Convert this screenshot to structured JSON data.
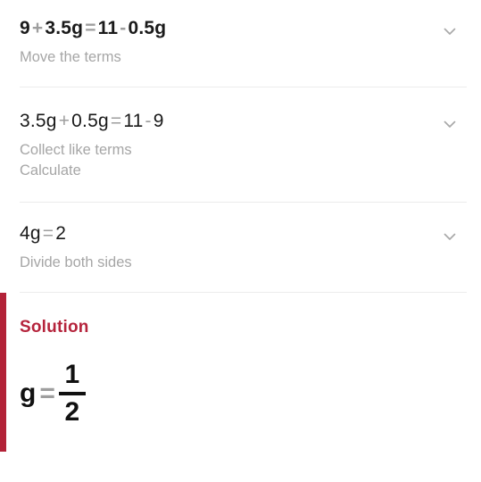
{
  "panel": {
    "accent_color": "#b32238",
    "solution_color": "#b5243c",
    "operator_color": "#9e9e9e",
    "hint_color": "#a6a6a6",
    "divider_color": "#ececec"
  },
  "steps": [
    {
      "equation_text": "9 + 3.5 g = 11 - 0.5 g",
      "parts": {
        "t1": "9",
        "op1": "+",
        "t2": "3.5g",
        "op2": "=",
        "t3": "11",
        "op3": "-",
        "t4": "0.5g"
      },
      "hints": [
        "Move the terms"
      ],
      "expand_icon": "chevron-down-icon"
    },
    {
      "equation_text": "3.5 g + 0.5 g = 11 - 9",
      "parts": {
        "t1": "3.5g",
        "op1": "+",
        "t2": "0.5g",
        "op2": "=",
        "t3": "11",
        "op3": "-",
        "t4": "9"
      },
      "hints": [
        "Collect like terms",
        "Calculate"
      ],
      "expand_icon": "chevron-down-icon"
    },
    {
      "equation_text": "4 g = 2",
      "parts": {
        "t1": "4g",
        "op1": "=",
        "t2": "2"
      },
      "hints": [
        "Divide both sides"
      ],
      "expand_icon": "chevron-down-icon"
    }
  ],
  "solution": {
    "title": "Solution",
    "variable": "g",
    "operator": "=",
    "numerator": "1",
    "denominator": "2",
    "value_text": "g = 1/2"
  }
}
